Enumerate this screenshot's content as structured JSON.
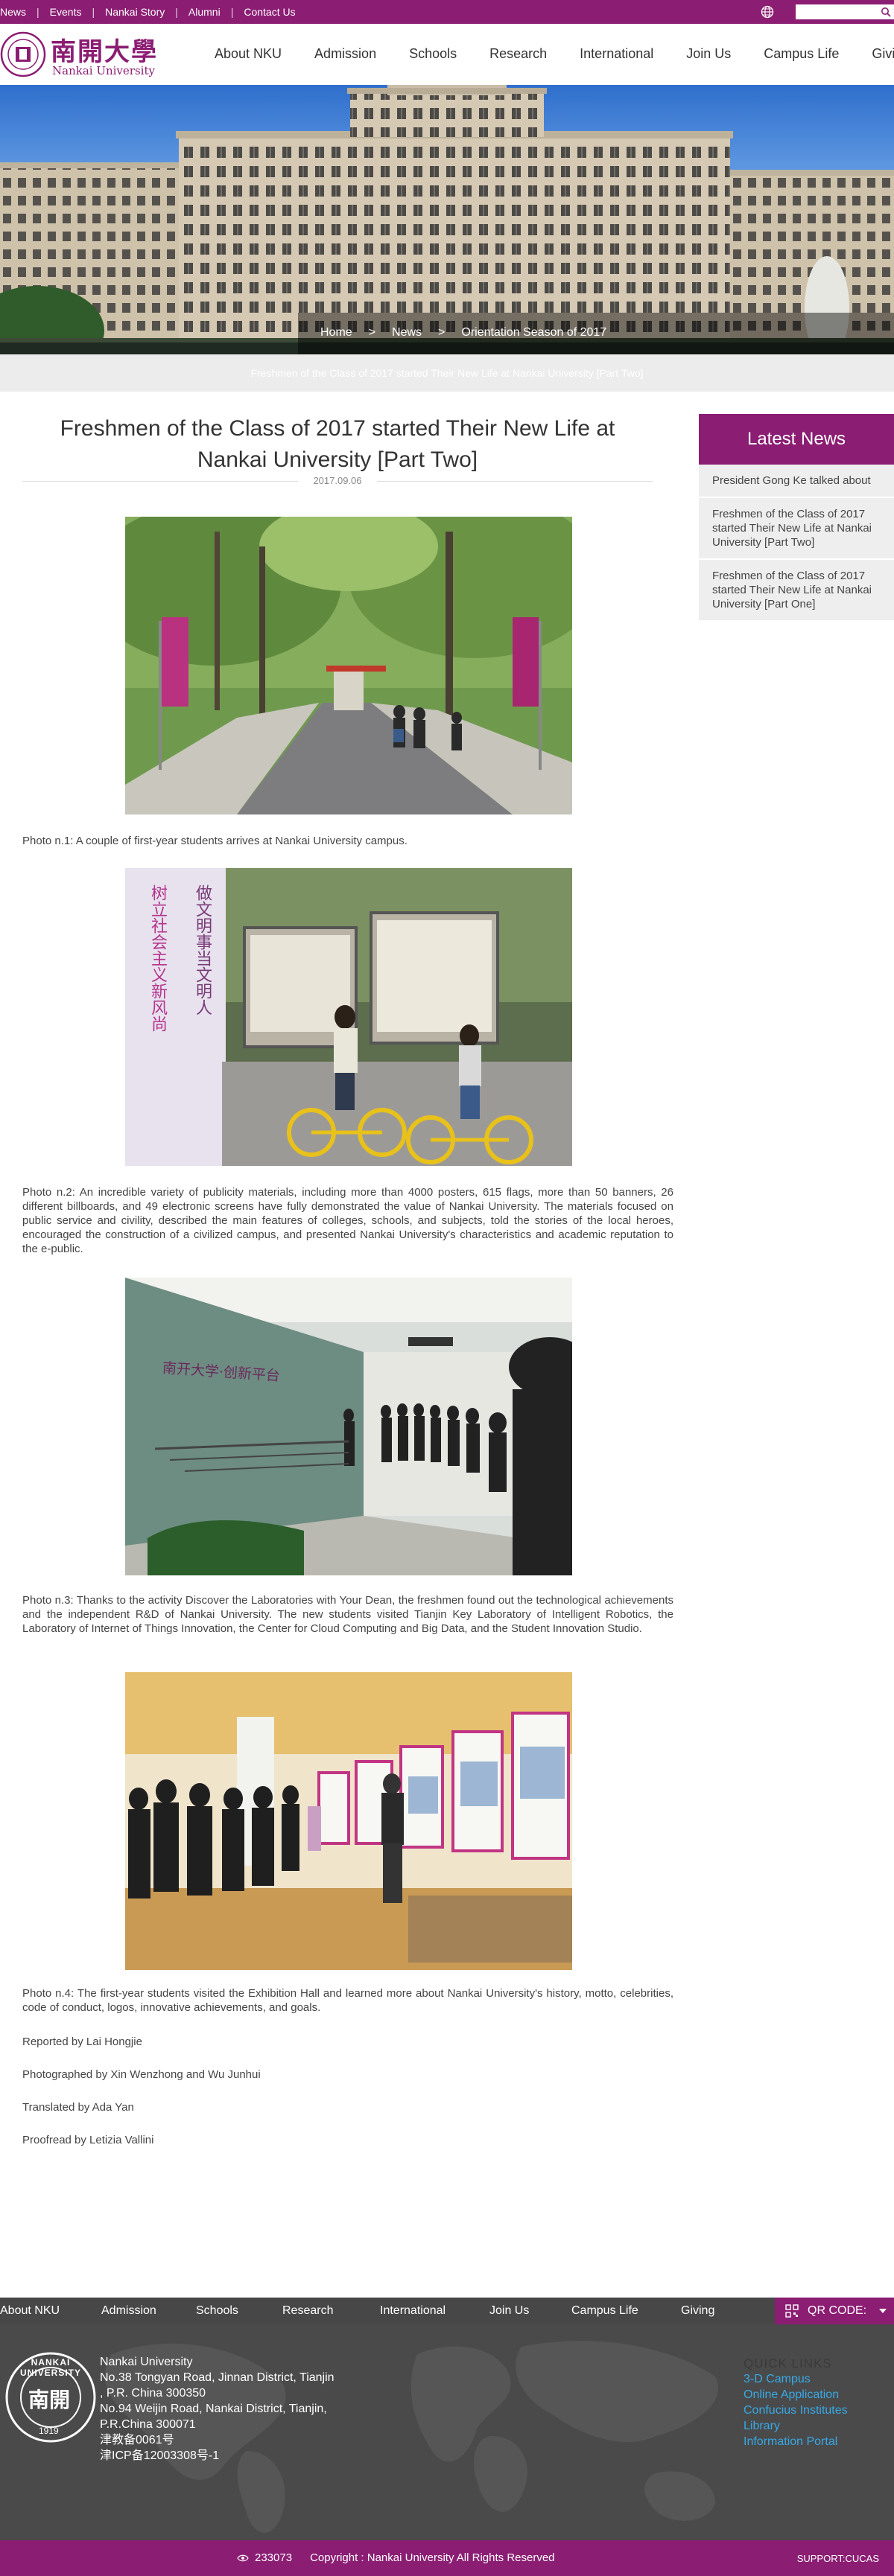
{
  "topbar": {
    "links": [
      "News",
      "Events",
      "Nankai Story",
      "Alumni",
      "Contact Us"
    ],
    "search_placeholder": ""
  },
  "header": {
    "logo_cn": "南開大學",
    "logo_en": "Nankai University",
    "nav": [
      "About NKU",
      "Admission",
      "Schools",
      "Research",
      "International",
      "Join Us",
      "Campus Life",
      "Giving"
    ]
  },
  "banner": {
    "breadcrumb": [
      "Home",
      ">",
      "News",
      ">",
      "Orientation Season of 2017"
    ],
    "ghost_text": "Freshmen of the Class of 2017 started Their New Life at Nankai University [Part Two]"
  },
  "article": {
    "title": "Freshmen of the Class of 2017 started Their New Life at Nankai University [Part Two]",
    "date": "2017.09.06",
    "captions": [
      "Photo n.1: A couple of first-year students arrives at Nankai University campus.",
      "Photo n.2: An incredible variety of publicity materials, including more than 4000 posters, 615 flags, more than 50 banners, 26 different billboards, and 49 electronic screens have fully demonstrated the value of Nankai University. The materials focused on public service and civility, described the main features of colleges, schools, and subjects, told the stories of the local heroes, encouraged the construction of a civilized campus, and presented Nankai University's characteristics and academic reputation to the e-public.",
      "Photo n.3: Thanks to the activity Discover the Laboratories with Your Dean, the freshmen found out the technological achievements and the independent R&D of Nankai University. The new students visited Tianjin Key Laboratory of Intelligent Robotics, the Laboratory of Internet of Things Innovation, the Center for Cloud Computing and Big Data, and the Student Innovation Studio.",
      "Photo n.4: The first-year students visited the Exhibition Hall and learned more about Nankai University's history, motto, celebrities, code of conduct, logos, innovative achievements, and goals."
    ],
    "credits": [
      "Reported by Lai Hongjie",
      "Photographed by Xin Wenzhong and Wu Junhui",
      "Translated by Ada Yan",
      "Proofread by Letizia Vallini"
    ],
    "photo2_slogan_left": "树立社会主义新风尚",
    "photo2_slogan_right": "做文明事当文明人",
    "photo3_wall_text": "南开大学·创新平台"
  },
  "sidebar": {
    "heading": "Latest News",
    "items": [
      "President Gong Ke talked about",
      "Freshmen of the Class of 2017 started Their New Life at Nankai University [Part Two]",
      "Freshmen of the Class of 2017 started Their New Life at Nankai University [Part One]"
    ]
  },
  "footer": {
    "nav": [
      "About NKU",
      "Admission",
      "Schools",
      "Research",
      "International",
      "Join Us",
      "Campus Life",
      "Giving"
    ],
    "qr_label": "QR CODE:",
    "seal_text": "NANKAI UNIVERSITY",
    "seal_cn": "南開",
    "seal_year": "1919",
    "address_lines": [
      "Nankai University",
      "No.38 Tongyan Road, Jinnan District, Tianjin",
      ", P.R. China 300350",
      "No.94 Weijin Road,  Nankai District, Tianjin,",
      "P.R.China  300071",
      "津教备0061号",
      "津ICP备12003308号-1"
    ],
    "quick_links_title": "QUICK LINKS",
    "quick_links": [
      "3-D Campus",
      "Online Application",
      "Confucius Institutes",
      "Library",
      "Information Portal"
    ],
    "visits": "233073",
    "copyright": "Copyright : Nankai University All Rights Reserved",
    "support": "SUPPORT:CUCAS"
  },
  "colors": {
    "brand": "#8b1d73",
    "link": "#37a9e6",
    "footer_bg": "#4a4a4a"
  }
}
